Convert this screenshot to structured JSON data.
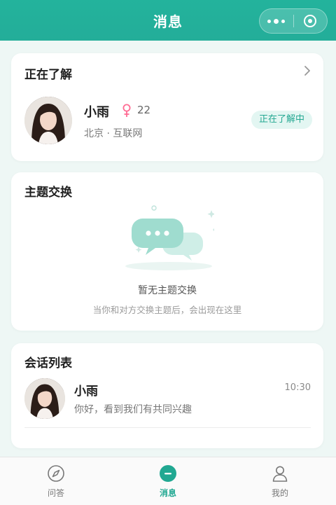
{
  "header": {
    "title": "消息"
  },
  "colors": {
    "accent": "#23b39c",
    "badge_text": "#24a892",
    "gender": "#ff6b93"
  },
  "current": {
    "title": "正在了解",
    "name": "小雨",
    "gender_icon": "female-icon",
    "age": "22",
    "meta": "北京 · 互联网",
    "badge": "正在了解中"
  },
  "topics": {
    "title": "主题交换",
    "empty_title": "暂无主题交换",
    "empty_sub": "当你和对方交换主题后，会出现在这里"
  },
  "conversations": {
    "title": "会话列表",
    "items": [
      {
        "name": "小雨",
        "time": "10:30",
        "preview": "你好，看到我们有共同兴趣"
      }
    ]
  },
  "tabbar": {
    "items": [
      {
        "label": "问答",
        "icon": "compass-icon"
      },
      {
        "label": "消息",
        "icon": "message-icon"
      },
      {
        "label": "我的",
        "icon": "user-icon"
      }
    ]
  }
}
